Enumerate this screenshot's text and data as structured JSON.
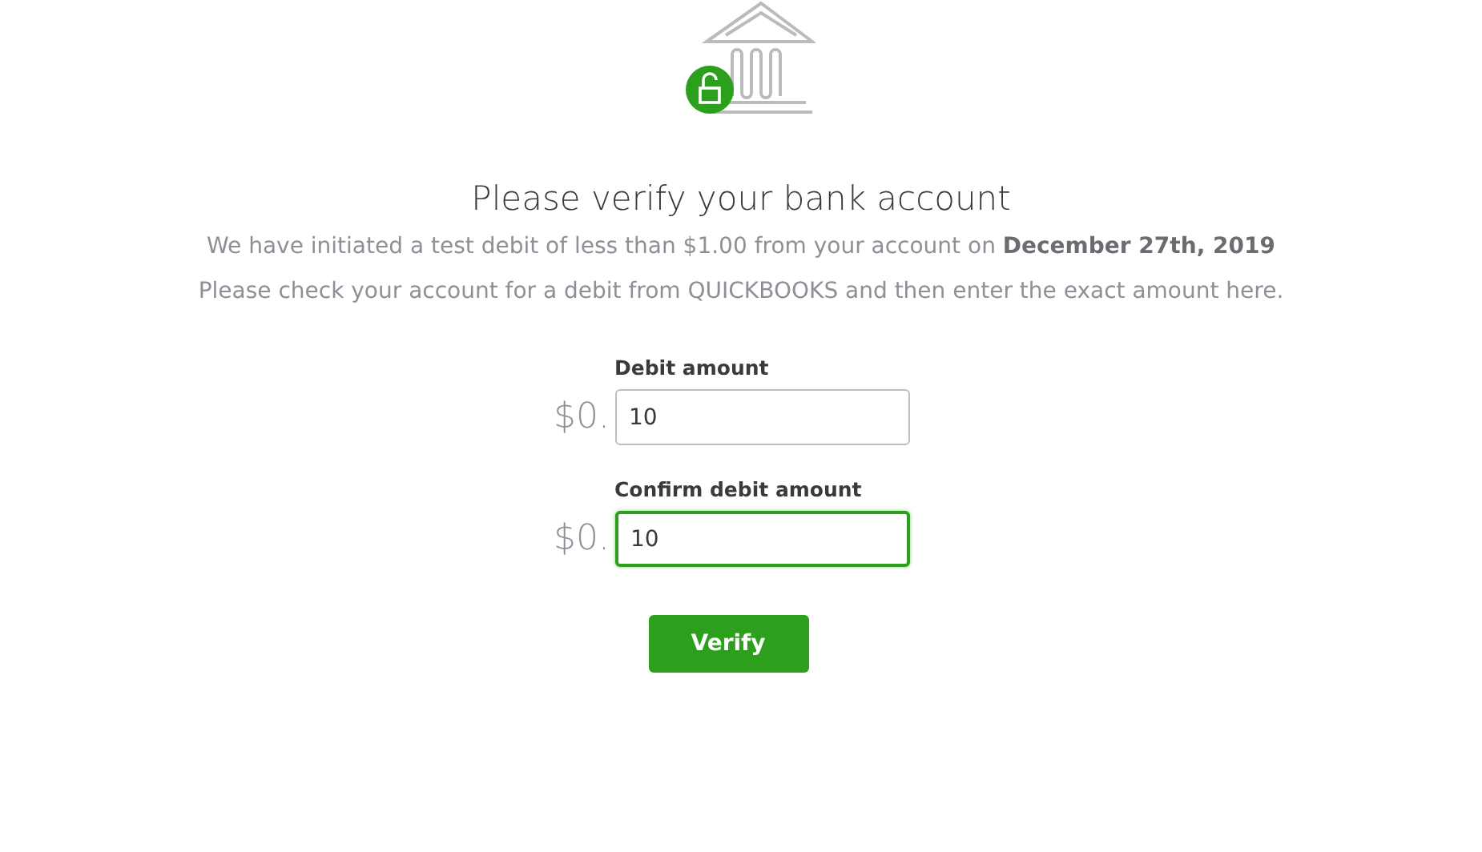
{
  "title": "Please verify your bank account",
  "messages": [
    "We have initiated a test debit of less than $1.00 from your account on **December 27th, 2019**",
    "Please check your account for a debit from QUICKBOOKS and then enter the exact amount here."
  ],
  "fields": [
    {
      "label": "Debit amount",
      "prefix": "$0.",
      "value": "10",
      "focused": false
    },
    {
      "label": "Confirm debit amount",
      "prefix": "$0.",
      "value": "10",
      "focused": true
    }
  ],
  "button": "Verify"
}
